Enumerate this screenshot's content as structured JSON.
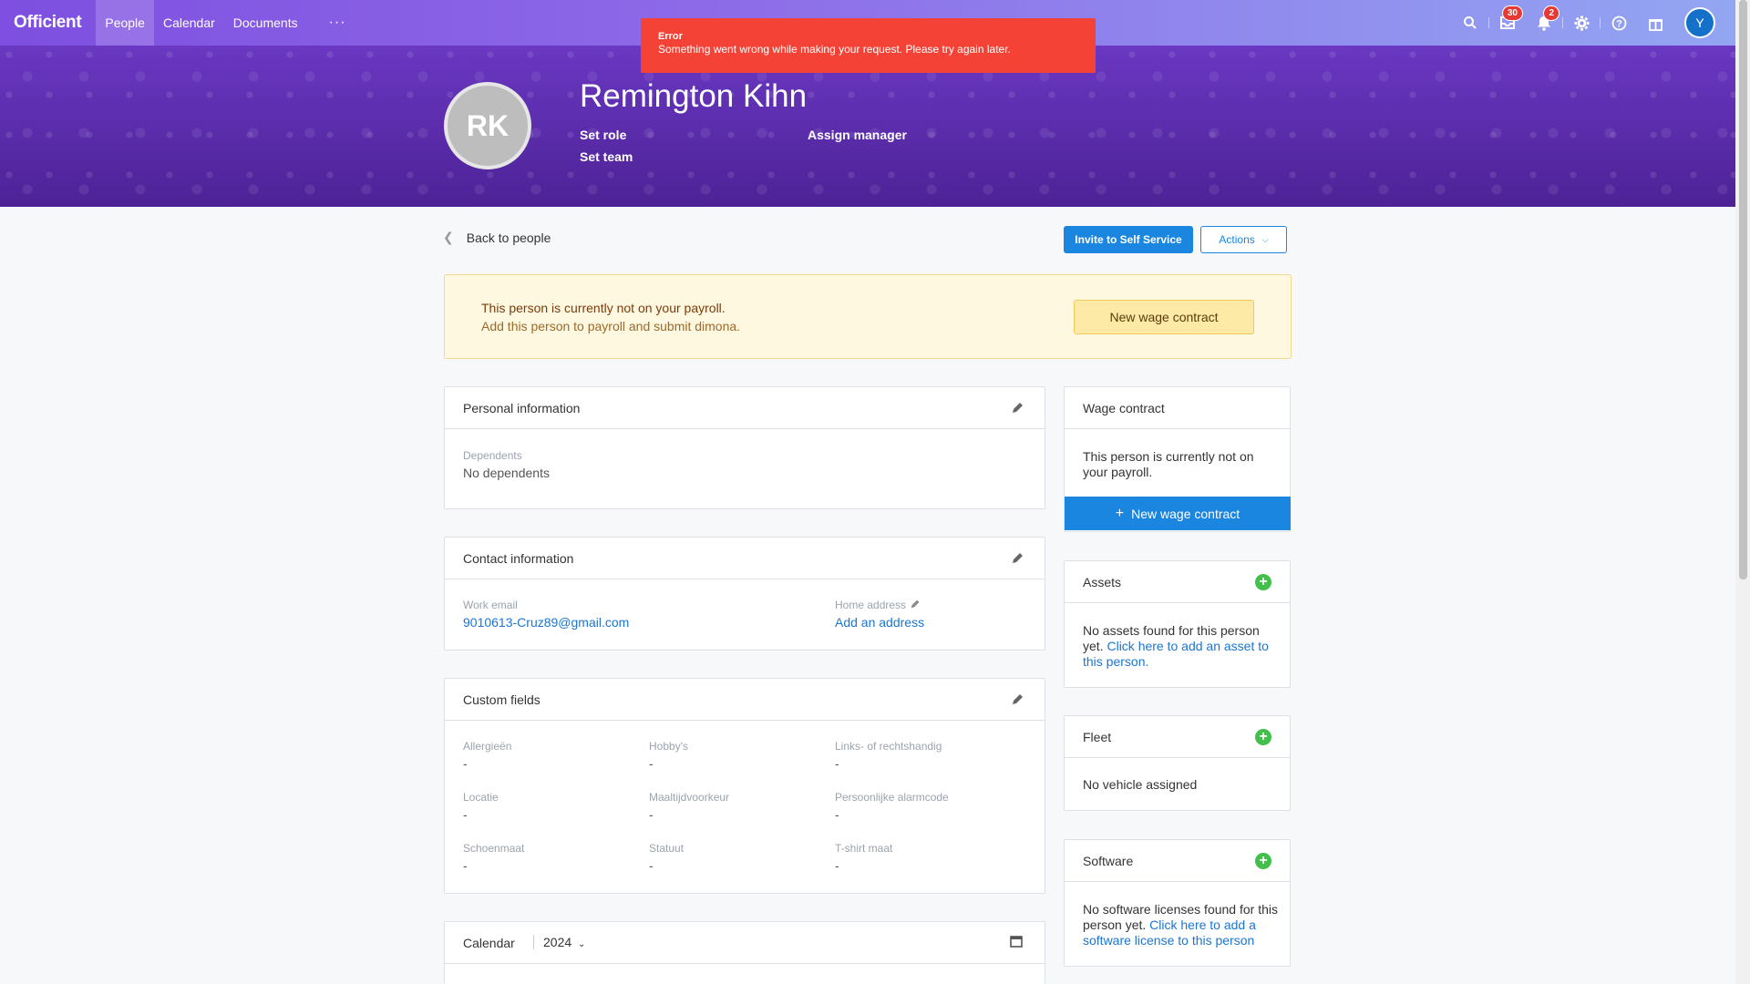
{
  "nav": {
    "logo": "Officient",
    "links": [
      "People",
      "Calendar",
      "Documents"
    ],
    "more": "···",
    "inbox_badge": "30",
    "notifications_badge": "2",
    "user_initial": "Y"
  },
  "toast": {
    "title": "Error",
    "message": "Something went wrong while making your request. Please try again later.",
    "color": "#f44336"
  },
  "hero": {
    "initials": "RK",
    "name": "Remington Kihn",
    "set_role": "Set role",
    "assign_manager": "Assign manager",
    "set_team": "Set team"
  },
  "toolbar": {
    "back": "Back to people",
    "invite": "Invite to Self Service",
    "actions": "Actions"
  },
  "notice": {
    "title": "This person is currently not on your payroll.",
    "subtitle": "Add this person to payroll and submit dimona.",
    "button": "New wage contract"
  },
  "personal": {
    "title": "Personal information",
    "dependents_label": "Dependents",
    "dependents_value": "No dependents"
  },
  "contact": {
    "title": "Contact information",
    "work_email_label": "Work email",
    "work_email": "9010613-Cruz89@gmail.com",
    "home_address_label": "Home address",
    "add_address": "Add an address"
  },
  "custom": {
    "title": "Custom fields",
    "fields": [
      {
        "label": "Allergieën",
        "value": "-"
      },
      {
        "label": "Hobby's",
        "value": "-"
      },
      {
        "label": "Links- of rechtshandig",
        "value": "-"
      },
      {
        "label": "Locatie",
        "value": "-"
      },
      {
        "label": "Maaltijdvoorkeur",
        "value": "-"
      },
      {
        "label": "Persoonlijke alarmcode",
        "value": "-"
      },
      {
        "label": "Schoenmaat",
        "value": "-"
      },
      {
        "label": "Statuut",
        "value": "-"
      },
      {
        "label": "T-shirt maat",
        "value": "-"
      }
    ]
  },
  "calendar": {
    "title": "Calendar",
    "year": "2024"
  },
  "wage": {
    "title": "Wage contract",
    "text": "This person is currently not on your payroll.",
    "button": "New wage contract"
  },
  "assets": {
    "title": "Assets",
    "text": "No assets found for this person yet.",
    "link": "Click here to add an asset to this person."
  },
  "fleet": {
    "title": "Fleet",
    "text": "No vehicle assigned"
  },
  "software": {
    "title": "Software",
    "text": "No software licenses found for this person yet.",
    "link": "Click here to add a software license to this person"
  }
}
